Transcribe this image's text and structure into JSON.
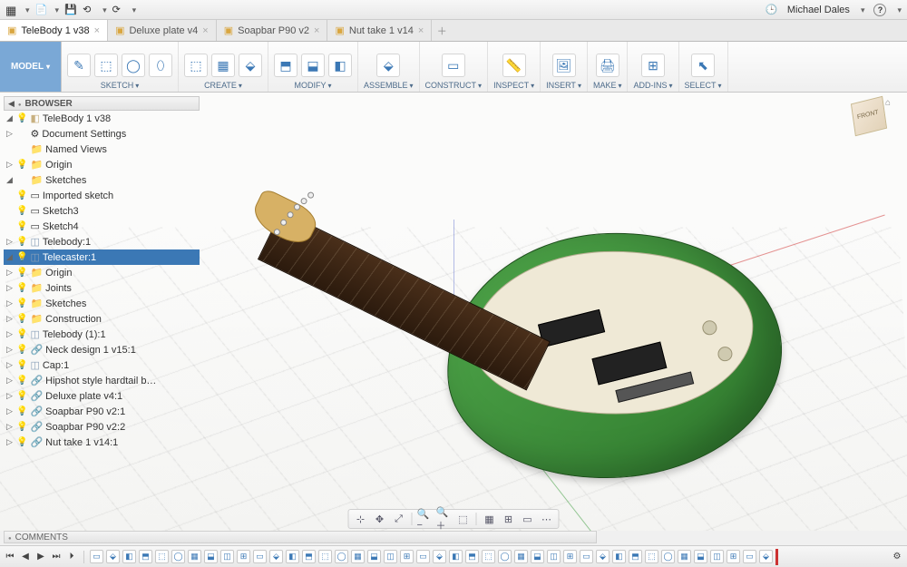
{
  "chrome": {
    "user": "Michael Dales"
  },
  "tabs": [
    {
      "label": "TeleBody 1 v38",
      "active": true
    },
    {
      "label": "Deluxe plate v4",
      "active": false
    },
    {
      "label": "Soapbar P90 v2",
      "active": false
    },
    {
      "label": "Nut take 1 v14",
      "active": false
    }
  ],
  "ribbon": {
    "model": "MODEL",
    "groups": [
      {
        "label": "SKETCH",
        "icons": [
          "✎",
          "⬚",
          "◯",
          "⬯"
        ]
      },
      {
        "label": "CREATE",
        "icons": [
          "⬚",
          "▦",
          "⬙"
        ]
      },
      {
        "label": "MODIFY",
        "icons": [
          "⬒",
          "⬓",
          "◧"
        ]
      },
      {
        "label": "ASSEMBLE",
        "icons": [
          "⬙"
        ]
      },
      {
        "label": "CONSTRUCT",
        "icons": [
          "▭"
        ]
      },
      {
        "label": "INSPECT",
        "icons": [
          "📏"
        ]
      },
      {
        "label": "INSERT",
        "icons": [
          "🖼"
        ]
      },
      {
        "label": "MAKE",
        "icons": [
          "🖨"
        ]
      },
      {
        "label": "ADD-INS",
        "icons": [
          "⊞"
        ]
      },
      {
        "label": "SELECT",
        "icons": [
          "⬉"
        ]
      }
    ]
  },
  "browser": {
    "title": "BROWSER",
    "root": "TeleBody 1 v38",
    "nodes": [
      {
        "depth": 0,
        "exp": "◢",
        "icon": "cube",
        "label": "TeleBody 1 v38",
        "sel": false,
        "bulb": "on"
      },
      {
        "depth": 1,
        "exp": "▷",
        "icon": "gear",
        "label": "Document Settings"
      },
      {
        "depth": 1,
        "exp": "",
        "icon": "fold",
        "label": "Named Views"
      },
      {
        "depth": 1,
        "exp": "▷",
        "icon": "fold",
        "label": "Origin",
        "bulb": "off"
      },
      {
        "depth": 1,
        "exp": "◢",
        "icon": "fold",
        "label": "Sketches"
      },
      {
        "depth": 2,
        "exp": "",
        "icon": "sk",
        "label": "Imported sketch",
        "bulb": "on"
      },
      {
        "depth": 2,
        "exp": "",
        "icon": "sk",
        "label": "Sketch3",
        "bulb": "on"
      },
      {
        "depth": 2,
        "exp": "",
        "icon": "sk",
        "label": "Sketch4",
        "bulb": "on"
      },
      {
        "depth": 1,
        "exp": "▷",
        "icon": "comp",
        "label": "Telebody:1",
        "bulb": "on"
      },
      {
        "depth": 1,
        "exp": "◢",
        "icon": "comp",
        "label": "Telecaster:1",
        "bulb": "on",
        "sel": true
      },
      {
        "depth": 2,
        "exp": "▷",
        "icon": "fold",
        "label": "Origin",
        "bulb": "on"
      },
      {
        "depth": 2,
        "exp": "▷",
        "icon": "fold",
        "label": "Joints",
        "bulb": "on"
      },
      {
        "depth": 2,
        "exp": "▷",
        "icon": "fold",
        "label": "Sketches",
        "bulb": "on"
      },
      {
        "depth": 2,
        "exp": "▷",
        "icon": "fold",
        "label": "Construction",
        "bulb": "on"
      },
      {
        "depth": 2,
        "exp": "▷",
        "icon": "comp",
        "label": "Telebody (1):1",
        "bulb": "on"
      },
      {
        "depth": 2,
        "exp": "▷",
        "icon": "link",
        "label": "Neck design 1 v15:1",
        "bulb": "on"
      },
      {
        "depth": 2,
        "exp": "▷",
        "icon": "comp",
        "label": "Cap:1",
        "bulb": "on"
      },
      {
        "depth": 2,
        "exp": "▷",
        "icon": "link",
        "label": "Hipshot style hardtail b…",
        "bulb": "on"
      },
      {
        "depth": 2,
        "exp": "▷",
        "icon": "link",
        "label": "Deluxe plate v4:1",
        "bulb": "on"
      },
      {
        "depth": 2,
        "exp": "▷",
        "icon": "link",
        "label": "Soapbar P90 v2:1",
        "bulb": "on"
      },
      {
        "depth": 2,
        "exp": "▷",
        "icon": "link",
        "label": "Soapbar P90 v2:2",
        "bulb": "on"
      },
      {
        "depth": 2,
        "exp": "▷",
        "icon": "link",
        "label": "Nut take 1 v14:1",
        "bulb": "on"
      }
    ]
  },
  "viewcube": {
    "front": "FRONT",
    "home": "⌂"
  },
  "comments": {
    "title": "COMMENTS"
  },
  "viewtools": [
    "⊹",
    "✥",
    "⤢",
    "🔍−",
    "🔍＋",
    "⬚",
    "▦",
    "⊞",
    "▭",
    "⋯"
  ],
  "timeline": {
    "transport": [
      "⏮",
      "◀",
      "▶",
      "⏭",
      "⏵"
    ],
    "items_count": 42,
    "gear": "⚙"
  }
}
